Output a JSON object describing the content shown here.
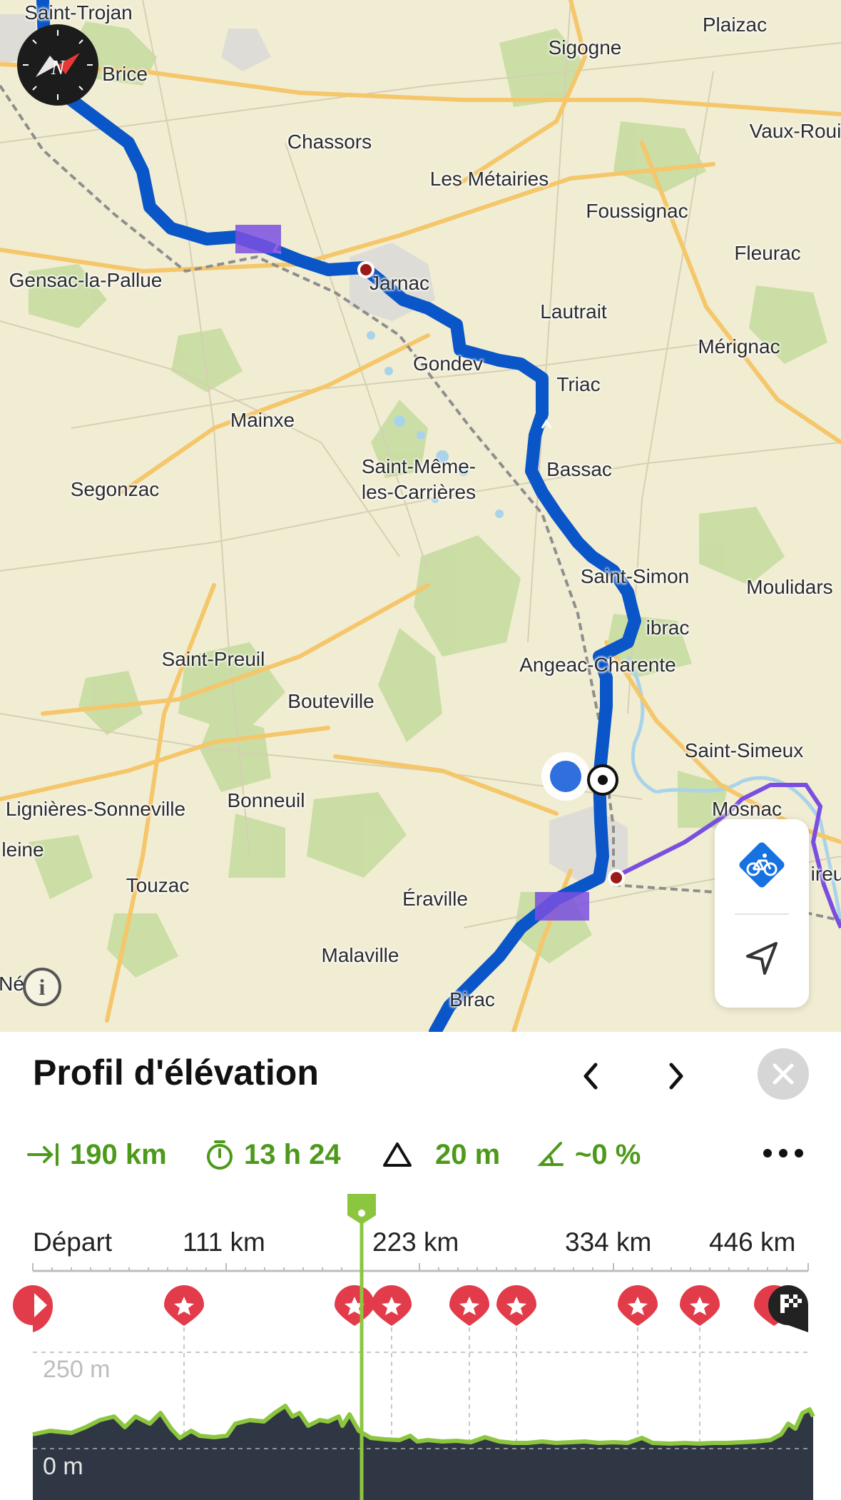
{
  "map": {
    "places": [
      {
        "name": "Saint-Trojan",
        "label": "Saint-Trojan"
      },
      {
        "name": "Plaizac",
        "label": "Plaizac"
      },
      {
        "name": "Brice",
        "label": "Brice"
      },
      {
        "name": "Sigogne",
        "label": "Sigogne"
      },
      {
        "name": "Chassors",
        "label": "Chassors"
      },
      {
        "name": "Vaux-Rouillac",
        "label": "Vaux-Roui"
      },
      {
        "name": "Les Metairies",
        "label": "Les Métairies"
      },
      {
        "name": "Foussignac",
        "label": "Foussignac"
      },
      {
        "name": "Fleurac",
        "label": "Fleurac"
      },
      {
        "name": "Gensac-la-Pallue",
        "label": "Gensac-la-Pallue"
      },
      {
        "name": "Jarnac",
        "label": "Jarnac"
      },
      {
        "name": "Lautrait",
        "label": "Lautrait"
      },
      {
        "name": "Merignac",
        "label": "Mérignac"
      },
      {
        "name": "Gondeville",
        "label": "Gondev"
      },
      {
        "name": "Triac",
        "label": "Triac"
      },
      {
        "name": "Mainxe",
        "label": "Mainxe"
      },
      {
        "name": "Saint-Meme-les-Carrieres-1",
        "label": "Saint-Même-"
      },
      {
        "name": "Saint-Meme-les-Carrieres-2",
        "label": "les-Carrières"
      },
      {
        "name": "Bassac",
        "label": "Bassac"
      },
      {
        "name": "Segonzac",
        "label": "Segonzac"
      },
      {
        "name": "Saint-Simon",
        "label": "Saint-Simon"
      },
      {
        "name": "Moulidars",
        "label": "Moulidars"
      },
      {
        "name": "Vibrac",
        "label": "ibrac"
      },
      {
        "name": "Saint-Preuil",
        "label": "Saint-Preuil"
      },
      {
        "name": "Angeac-Charente",
        "label": "Angeac-Charente"
      },
      {
        "name": "Bouteville",
        "label": "Bouteville"
      },
      {
        "name": "Saint-Simeux",
        "label": "Saint-Simeux"
      },
      {
        "name": "Bonneuil",
        "label": "Bonneuil"
      },
      {
        "name": "Lignieres-Sonneville",
        "label": "Lignières-Sonneville"
      },
      {
        "name": "Mosnac",
        "label": "Mosnac"
      },
      {
        "name": "Madeleine",
        "label": "leine"
      },
      {
        "name": "Touzac",
        "label": "Touzac"
      },
      {
        "name": "Eraville",
        "label": "Éraville"
      },
      {
        "name": "Saint-Estephe",
        "label": "ireu"
      },
      {
        "name": "Malaville",
        "label": "Malaville"
      },
      {
        "name": "Ne",
        "label": "Né"
      },
      {
        "name": "Birac",
        "label": "Birac"
      }
    ],
    "compass_letter": "N",
    "info_label": "i",
    "colors": {
      "route": "#0a56c8",
      "alt_route": "#7a4fe0",
      "map_bg": "#f1edd3",
      "forest": "#bfd99b",
      "road": "#f5c66a"
    }
  },
  "panel": {
    "title": "Profil d'élévation",
    "stats": {
      "distance": "190 km",
      "duration": "13 h 24",
      "elevation": "20 m",
      "grade": "~0 %"
    },
    "distance_markers": [
      "Départ",
      "111 km",
      "223 km",
      "334 km",
      "446 km"
    ],
    "elevation_labels": {
      "top": "250 m",
      "bottom": "0 m"
    },
    "accent_color": "#4d9a1b"
  }
}
